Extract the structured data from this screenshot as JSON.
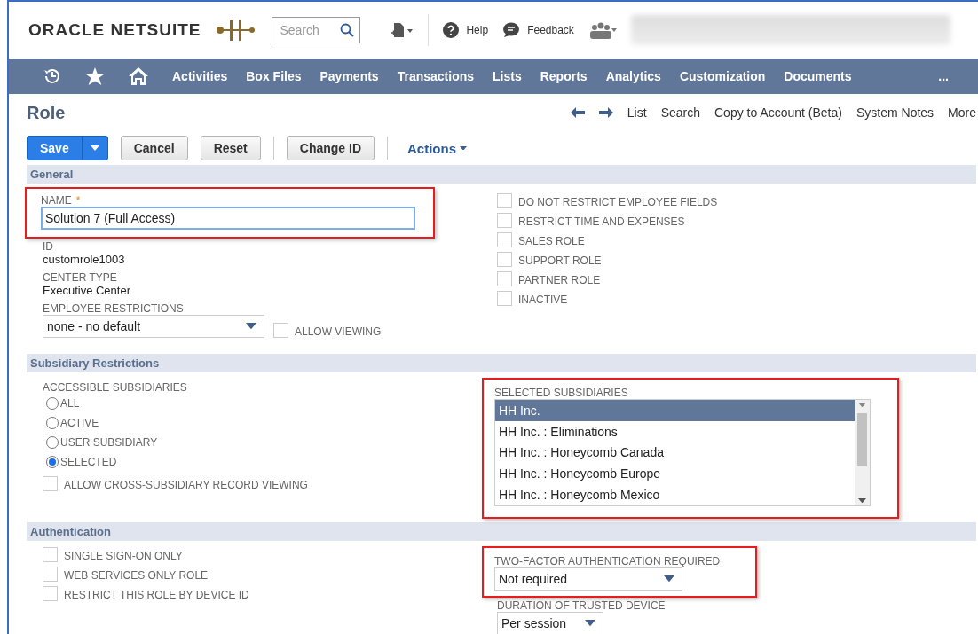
{
  "header": {
    "brand": "ORACLE NETSUITE",
    "search": {
      "placeholder": "Search"
    },
    "help": "Help",
    "feedback": "Feedback"
  },
  "nav": {
    "items": [
      "Activities",
      "Box Files",
      "Payments",
      "Transactions",
      "Lists",
      "Reports",
      "Analytics",
      "Customization",
      "Documents"
    ],
    "more": "..."
  },
  "page": {
    "title": "Role",
    "links": [
      "List",
      "Search",
      "Copy to Account (Beta)",
      "System Notes",
      "More"
    ]
  },
  "toolbar": {
    "buttons": [
      {
        "label": "Save",
        "kind": "primary"
      },
      {
        "label": "Cancel",
        "kind": "plain"
      },
      {
        "label": "Reset",
        "kind": "plain"
      },
      {
        "label": "Change ID",
        "kind": "plain"
      }
    ],
    "actions": "Actions"
  },
  "general": {
    "title": "General",
    "name": {
      "label": "NAME",
      "required_mark": "*",
      "value": "Solution 7 (Full Access)",
      "highlighted": true
    },
    "id": {
      "label": "ID",
      "value": "customrole1003"
    },
    "center_type": {
      "label": "CENTER TYPE",
      "value": "Executive Center"
    },
    "employee_restrictions": {
      "label": "EMPLOYEE RESTRICTIONS",
      "value": "none - no default"
    },
    "allow_viewing": {
      "label": "ALLOW VIEWING",
      "checked": false
    },
    "checkboxes": [
      {
        "label": "DO NOT RESTRICT EMPLOYEE FIELDS",
        "checked": false
      },
      {
        "label": "RESTRICT TIME AND EXPENSES",
        "checked": false
      },
      {
        "label": "SALES ROLE",
        "checked": false
      },
      {
        "label": "SUPPORT ROLE",
        "checked": false
      },
      {
        "label": "PARTNER ROLE",
        "checked": false
      },
      {
        "label": "INACTIVE",
        "checked": false
      }
    ]
  },
  "subsidiary": {
    "title": "Subsidiary Restrictions",
    "label": "ACCESSIBLE SUBSIDIARIES",
    "radios": [
      {
        "label": "ALL",
        "selected": false
      },
      {
        "label": "ACTIVE",
        "selected": false
      },
      {
        "label": "USER SUBSIDIARY",
        "selected": false
      },
      {
        "label": "SELECTED",
        "selected": true
      }
    ],
    "cross_viewing": {
      "label": "ALLOW CROSS-SUBSIDIARY RECORD VIEWING",
      "checked": false
    },
    "selected_list": {
      "label": "SELECTED SUBSIDIARIES",
      "highlighted": true,
      "items": [
        {
          "label": "HH Inc.",
          "selected": true
        },
        {
          "label": "HH Inc. : Eliminations",
          "selected": false
        },
        {
          "label": "HH Inc. : Honeycomb Canada",
          "selected": false
        },
        {
          "label": "HH Inc. : Honeycomb Europe",
          "selected": false
        },
        {
          "label": "HH Inc. : Honeycomb Mexico",
          "selected": false
        }
      ]
    }
  },
  "authentication": {
    "title": "Authentication",
    "checkboxes": [
      {
        "label": "SINGLE SIGN-ON ONLY",
        "checked": false
      },
      {
        "label": "WEB SERVICES ONLY ROLE",
        "checked": false
      },
      {
        "label": "RESTRICT THIS ROLE BY DEVICE ID",
        "checked": false
      }
    ],
    "two_factor": {
      "label": "TWO-FACTOR AUTHENTICATION REQUIRED",
      "value": "Not required",
      "highlighted": true
    },
    "trusted_device": {
      "label": "DURATION OF TRUSTED DEVICE",
      "value": "Per session"
    }
  }
}
